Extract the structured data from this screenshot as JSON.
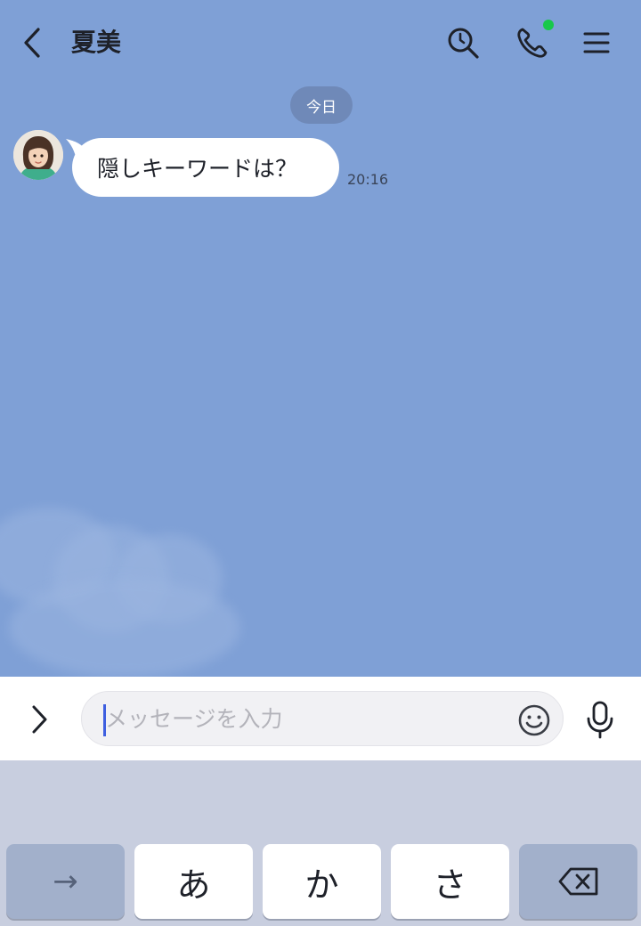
{
  "header": {
    "title": "夏美",
    "online_color": "#18c84a"
  },
  "chat": {
    "date_label": "今日",
    "messages": [
      {
        "sender": "夏美",
        "text": "隠しキーワードは？",
        "time": "20:16"
      }
    ]
  },
  "input": {
    "placeholder": "メッセージを入力",
    "value": ""
  },
  "keyboard": {
    "keys": [
      "→",
      "あ",
      "か",
      "さ"
    ]
  },
  "colors": {
    "chat_background": "#7fa0d6",
    "caret": "#3e5fe0"
  }
}
